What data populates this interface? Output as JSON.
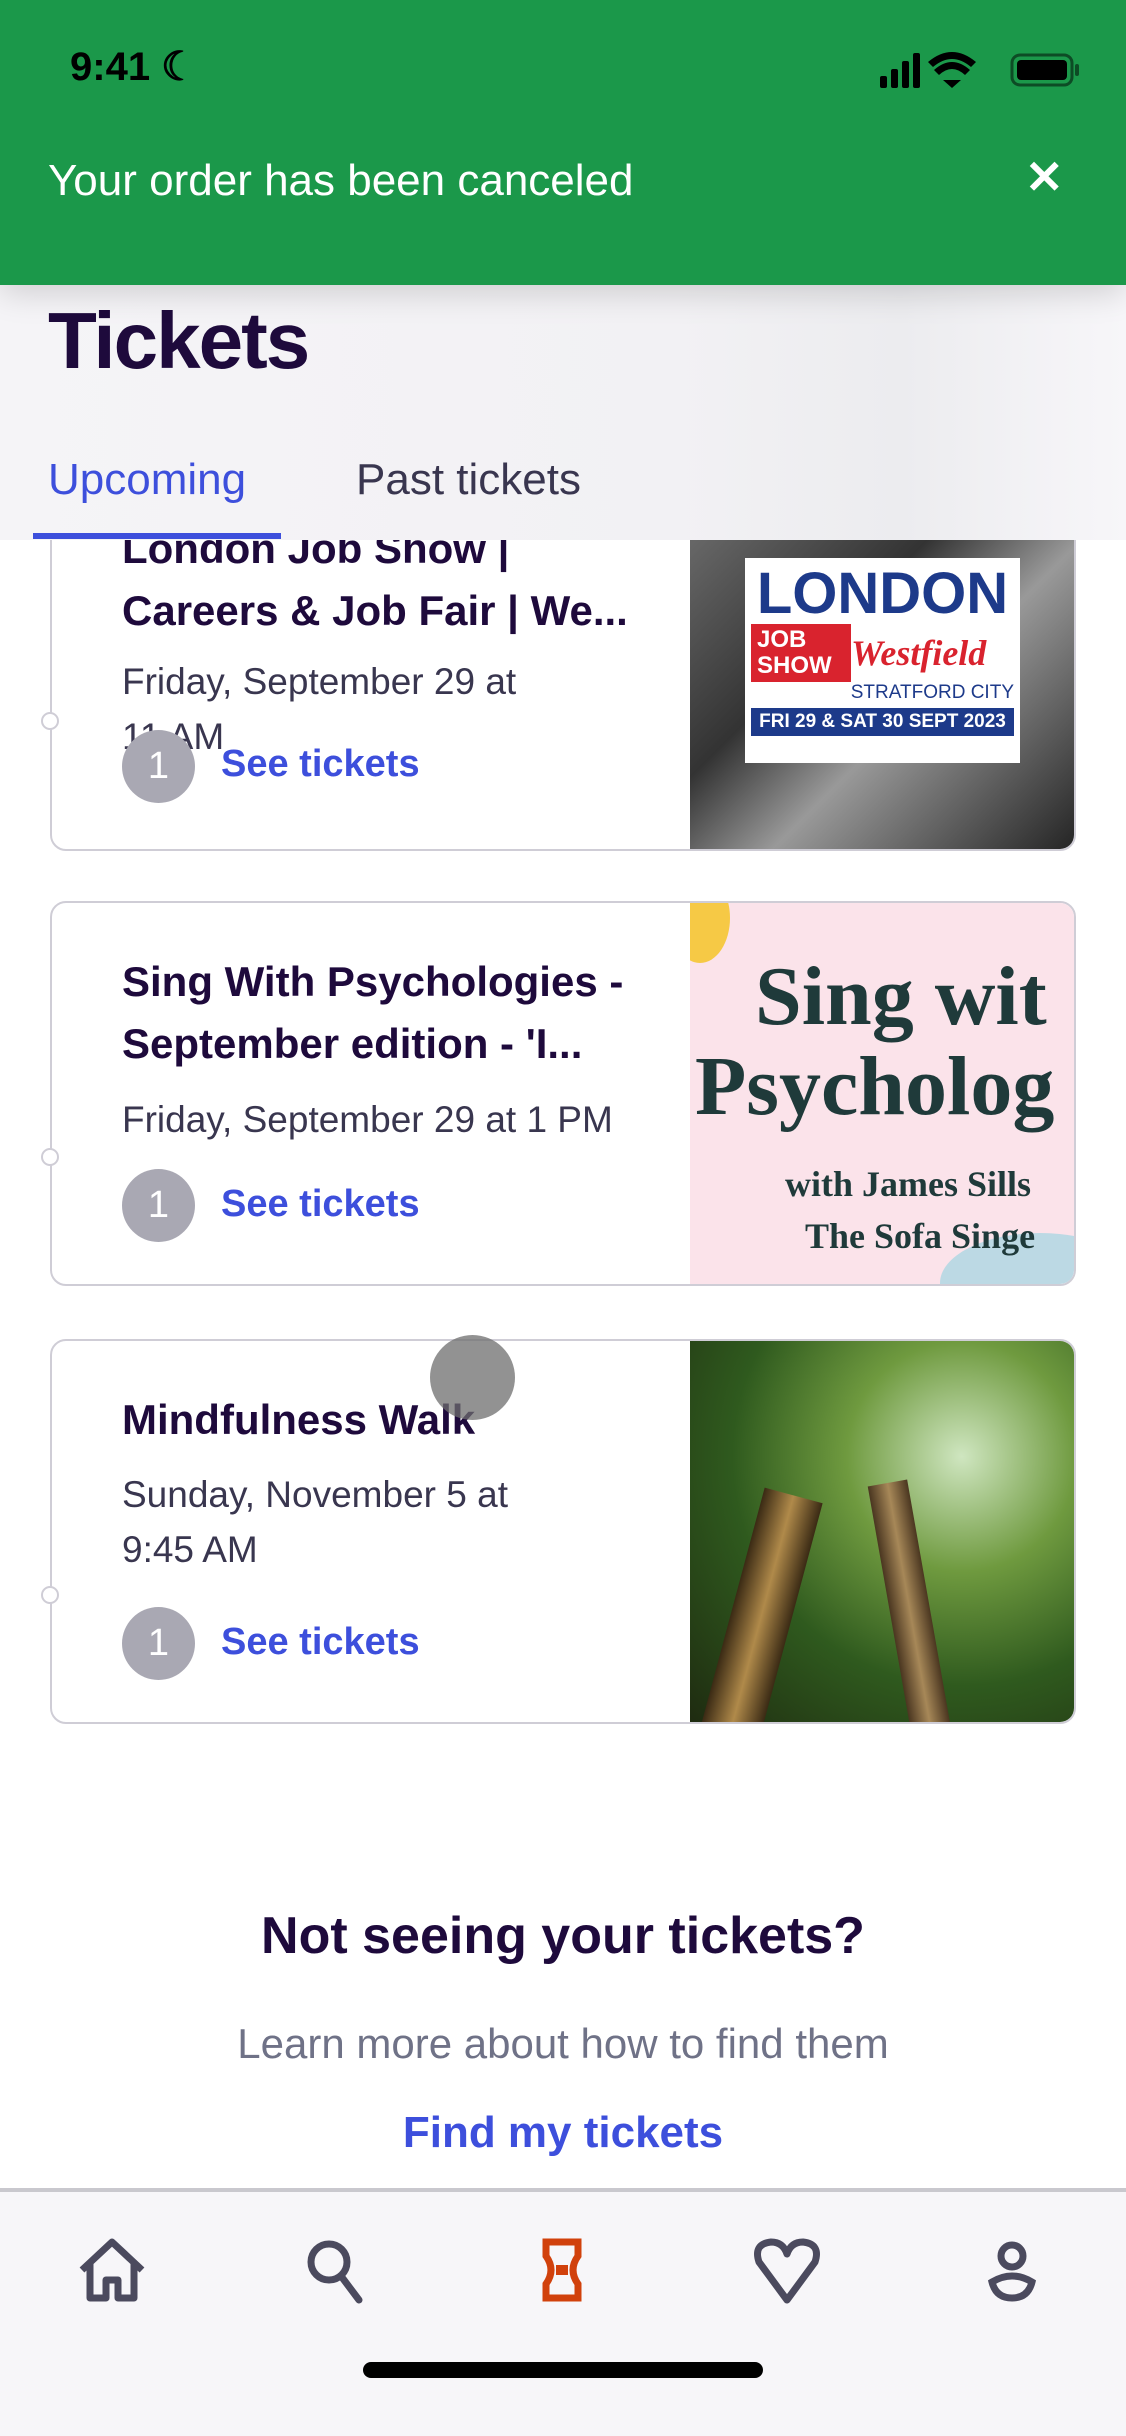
{
  "status_bar": {
    "time": "9:41"
  },
  "banner": {
    "message": "Your order has been canceled",
    "close": "✕",
    "color": "#1b984a"
  },
  "page": {
    "title": "Tickets"
  },
  "tabs": [
    {
      "label": "Upcoming",
      "active": true
    },
    {
      "label": "Past tickets",
      "active": false
    }
  ],
  "tickets": [
    {
      "title_line1": "London Job Show |",
      "title_line2": "Careers & Job Fair | We...",
      "date_line1": "Friday, September 29 at",
      "date_line2": "11 AM",
      "count": "1",
      "action": "See tickets",
      "image": {
        "l1": "LONDON",
        "l2": "JOB",
        "l3": "SHOW",
        "l4": "Westfield",
        "l5": "STRATFORD CITY",
        "l6": "FRI 29 & SAT 30 SEPT 2023"
      }
    },
    {
      "title_line1": "Sing With Psychologies -",
      "title_line2": "September edition - 'I...",
      "date_line1": "Friday, September 29 at 1 PM",
      "count": "1",
      "action": "See tickets",
      "image": {
        "l1": "Sing wit",
        "l2": "Psycholog",
        "l3": "with James Sills",
        "l4": "The Sofa Singe"
      }
    },
    {
      "title_line1": "Mindfulness Walk",
      "date_line1": "Sunday, November 5 at",
      "date_line2": "9:45 AM",
      "count": "1",
      "action": "See tickets"
    }
  ],
  "footer": {
    "heading": "Not seeing your tickets?",
    "subtext": "Learn more about how to find them",
    "link": "Find my tickets"
  },
  "nav": [
    {
      "icon": "home-icon"
    },
    {
      "icon": "search-icon"
    },
    {
      "icon": "ticket-icon",
      "active": true,
      "color": "#d1410c"
    },
    {
      "icon": "heart-icon"
    },
    {
      "icon": "profile-icon"
    }
  ]
}
